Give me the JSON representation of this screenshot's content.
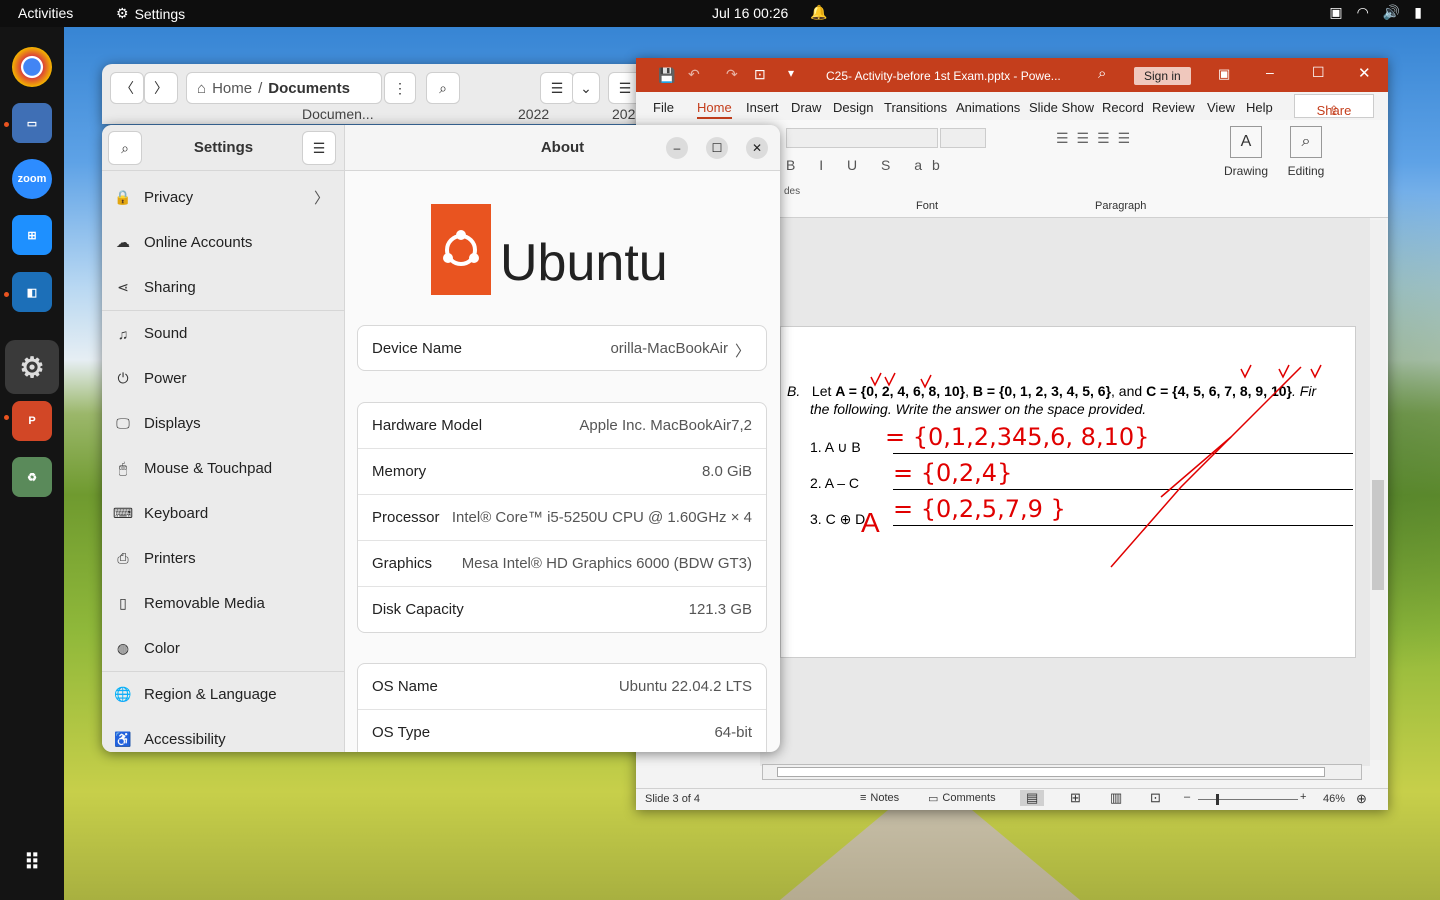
{
  "topbar": {
    "activities": "Activities",
    "app_name": "Settings",
    "clock": "Jul 16  00:26"
  },
  "dock": {
    "items": [
      "chrome",
      "files",
      "zoom",
      "windows",
      "virtualbox",
      "settings",
      "powerpoint",
      "trash"
    ],
    "zoom_label": "zoom"
  },
  "files": {
    "path_home": "Home",
    "path_sep": "/",
    "path_current": "Documents",
    "row_name": "Documen...",
    "row_year": "2022",
    "row_year2": "202"
  },
  "settings": {
    "sidebar_title": "Settings",
    "content_title": "About",
    "sidebar_items": [
      "Privacy",
      "Online Accounts",
      "Sharing",
      "Sound",
      "Power",
      "Displays",
      "Mouse & Touchpad",
      "Keyboard",
      "Printers",
      "Removable Media",
      "Color",
      "Region & Language",
      "Accessibility"
    ],
    "logo_text": "Ubuntu",
    "device": {
      "label": "Device Name",
      "value": "orilla-MacBookAir"
    },
    "hardware": [
      {
        "label": "Hardware Model",
        "value": "Apple Inc. MacBookAir7,2"
      },
      {
        "label": "Memory",
        "value": "8.0 GiB"
      },
      {
        "label": "Processor",
        "value": "Intel® Core™ i5-5250U CPU @ 1.60GHz × 4"
      },
      {
        "label": "Graphics",
        "value": "Mesa Intel® HD Graphics 6000 (BDW GT3)"
      },
      {
        "label": "Disk Capacity",
        "value": "121.3 GB"
      }
    ],
    "os": [
      {
        "label": "OS Name",
        "value": "Ubuntu 22.04.2 LTS"
      },
      {
        "label": "OS Type",
        "value": "64-bit"
      }
    ]
  },
  "ppt": {
    "title": "C25- Activity-before 1st Exam.pptx  -  Powe...",
    "signin": "Sign in",
    "tabs": [
      "File",
      "Home",
      "Insert",
      "Draw",
      "Design",
      "Transitions",
      "Animations",
      "Slide Show",
      "Record",
      "Review",
      "View",
      "Help"
    ],
    "share": "Share",
    "groups": {
      "font": "Font",
      "paragraph": "Paragraph",
      "slides_partial": "des",
      "drawing": "Drawing",
      "editing": "Editing"
    },
    "slide": {
      "intro_label": "B.",
      "intro_a": "Let ",
      "intro_bold1": "A = {0, 2, 4, 6, 8, 10}",
      "intro_b": ", ",
      "intro_bold2": "B = {0, 1, 2, 3, 4, 5, 6}",
      "intro_c": ", and ",
      "intro_bold3": "C = {4, 5, 6, 7, 8, 9, 10}",
      "intro_d": ". Fir",
      "instruction": "the following. Write the answer on the space provided.",
      "q1": "1.   A ∪ B",
      "q2": "2.   A – C",
      "q3": "3.   C ⊕ D",
      "hw1": "= {0,1,2,345,6, 8,10}",
      "hw2": "= {0,2,4}",
      "hw3": "= {0,2,5,7,9 }",
      "hw_a": "A"
    },
    "status": {
      "slide": "Slide 3 of 4",
      "notes": "Notes",
      "comments": "Comments",
      "zoom": "46%"
    }
  }
}
